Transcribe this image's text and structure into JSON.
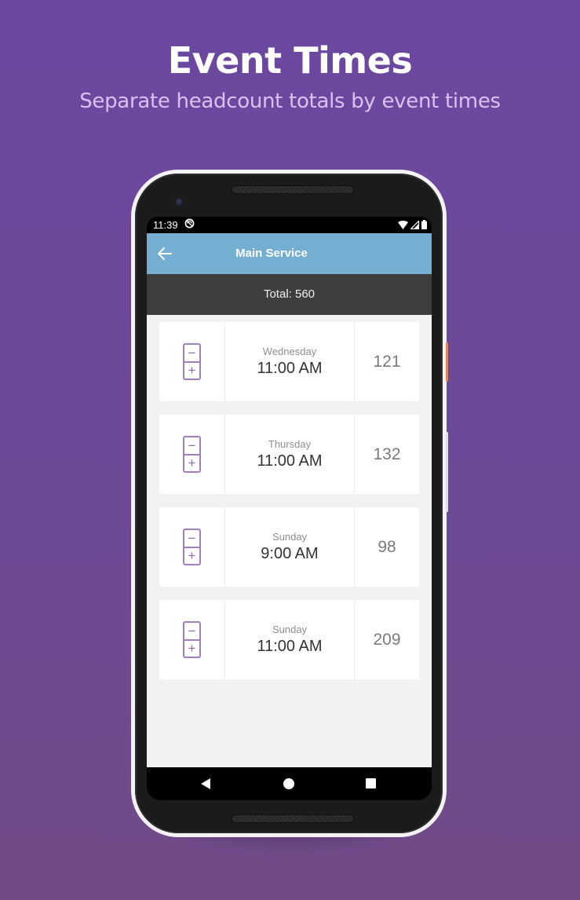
{
  "promo": {
    "headline": "Event Times",
    "subheadline": "Separate headcount totals by event times"
  },
  "status_bar": {
    "time": "11:39",
    "icons": [
      "sync-icon",
      "wifi-icon",
      "signal-icon",
      "battery-icon"
    ]
  },
  "app_bar": {
    "back_icon": "arrow-left-icon",
    "title": "Main Service",
    "color": "#74aed1"
  },
  "total_bar": {
    "label": "Total: 560"
  },
  "events": [
    {
      "day": "Wednesday",
      "time": "11:00 AM",
      "count": "121",
      "minus": "−",
      "plus": "+"
    },
    {
      "day": "Thursday",
      "time": "11:00 AM",
      "count": "132",
      "minus": "−",
      "plus": "+"
    },
    {
      "day": "Sunday",
      "time": "9:00 AM",
      "count": "98",
      "minus": "−",
      "plus": "+"
    },
    {
      "day": "Sunday",
      "time": "11:00 AM",
      "count": "209",
      "minus": "−",
      "plus": "+"
    }
  ],
  "nav_bar": {
    "buttons": [
      "back",
      "home",
      "recents"
    ]
  },
  "colors": {
    "background": "#6b48a0",
    "subheadline": "#d9c2f0",
    "stepper": "#9f80b8"
  }
}
